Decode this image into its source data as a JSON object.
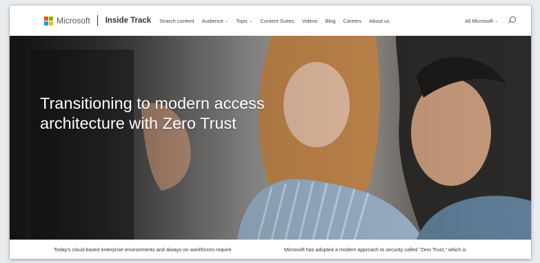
{
  "header": {
    "logo_text": "Microsoft",
    "site_name": "Inside Track",
    "nav": [
      {
        "label": "Search content",
        "has_dropdown": false
      },
      {
        "label": "Audience",
        "has_dropdown": true
      },
      {
        "label": "Topic",
        "has_dropdown": true
      },
      {
        "label": "Content Suites",
        "has_dropdown": false
      },
      {
        "label": "Videos",
        "has_dropdown": false
      },
      {
        "label": "Blog",
        "has_dropdown": false
      },
      {
        "label": "Careers",
        "has_dropdown": false
      },
      {
        "label": "About us",
        "has_dropdown": false
      }
    ],
    "all_microsoft": "All Microsoft",
    "search_icon": "search-icon",
    "chevron_icon": "chevron-down-icon"
  },
  "hero": {
    "title": "Transitioning to modern access architecture with Zero Trust"
  },
  "intro": {
    "left": "Today's cloud-based enterprise environments and always-on workforces require",
    "right": "Microsoft has adopted a modern approach to security called \"Zero Trust,\" which is"
  },
  "colors": {
    "logo_red": "#f25022",
    "logo_green": "#7fba00",
    "logo_blue": "#00a4ef",
    "logo_yellow": "#ffb900",
    "text_dark": "#333333",
    "hero_text": "#ffffff"
  }
}
